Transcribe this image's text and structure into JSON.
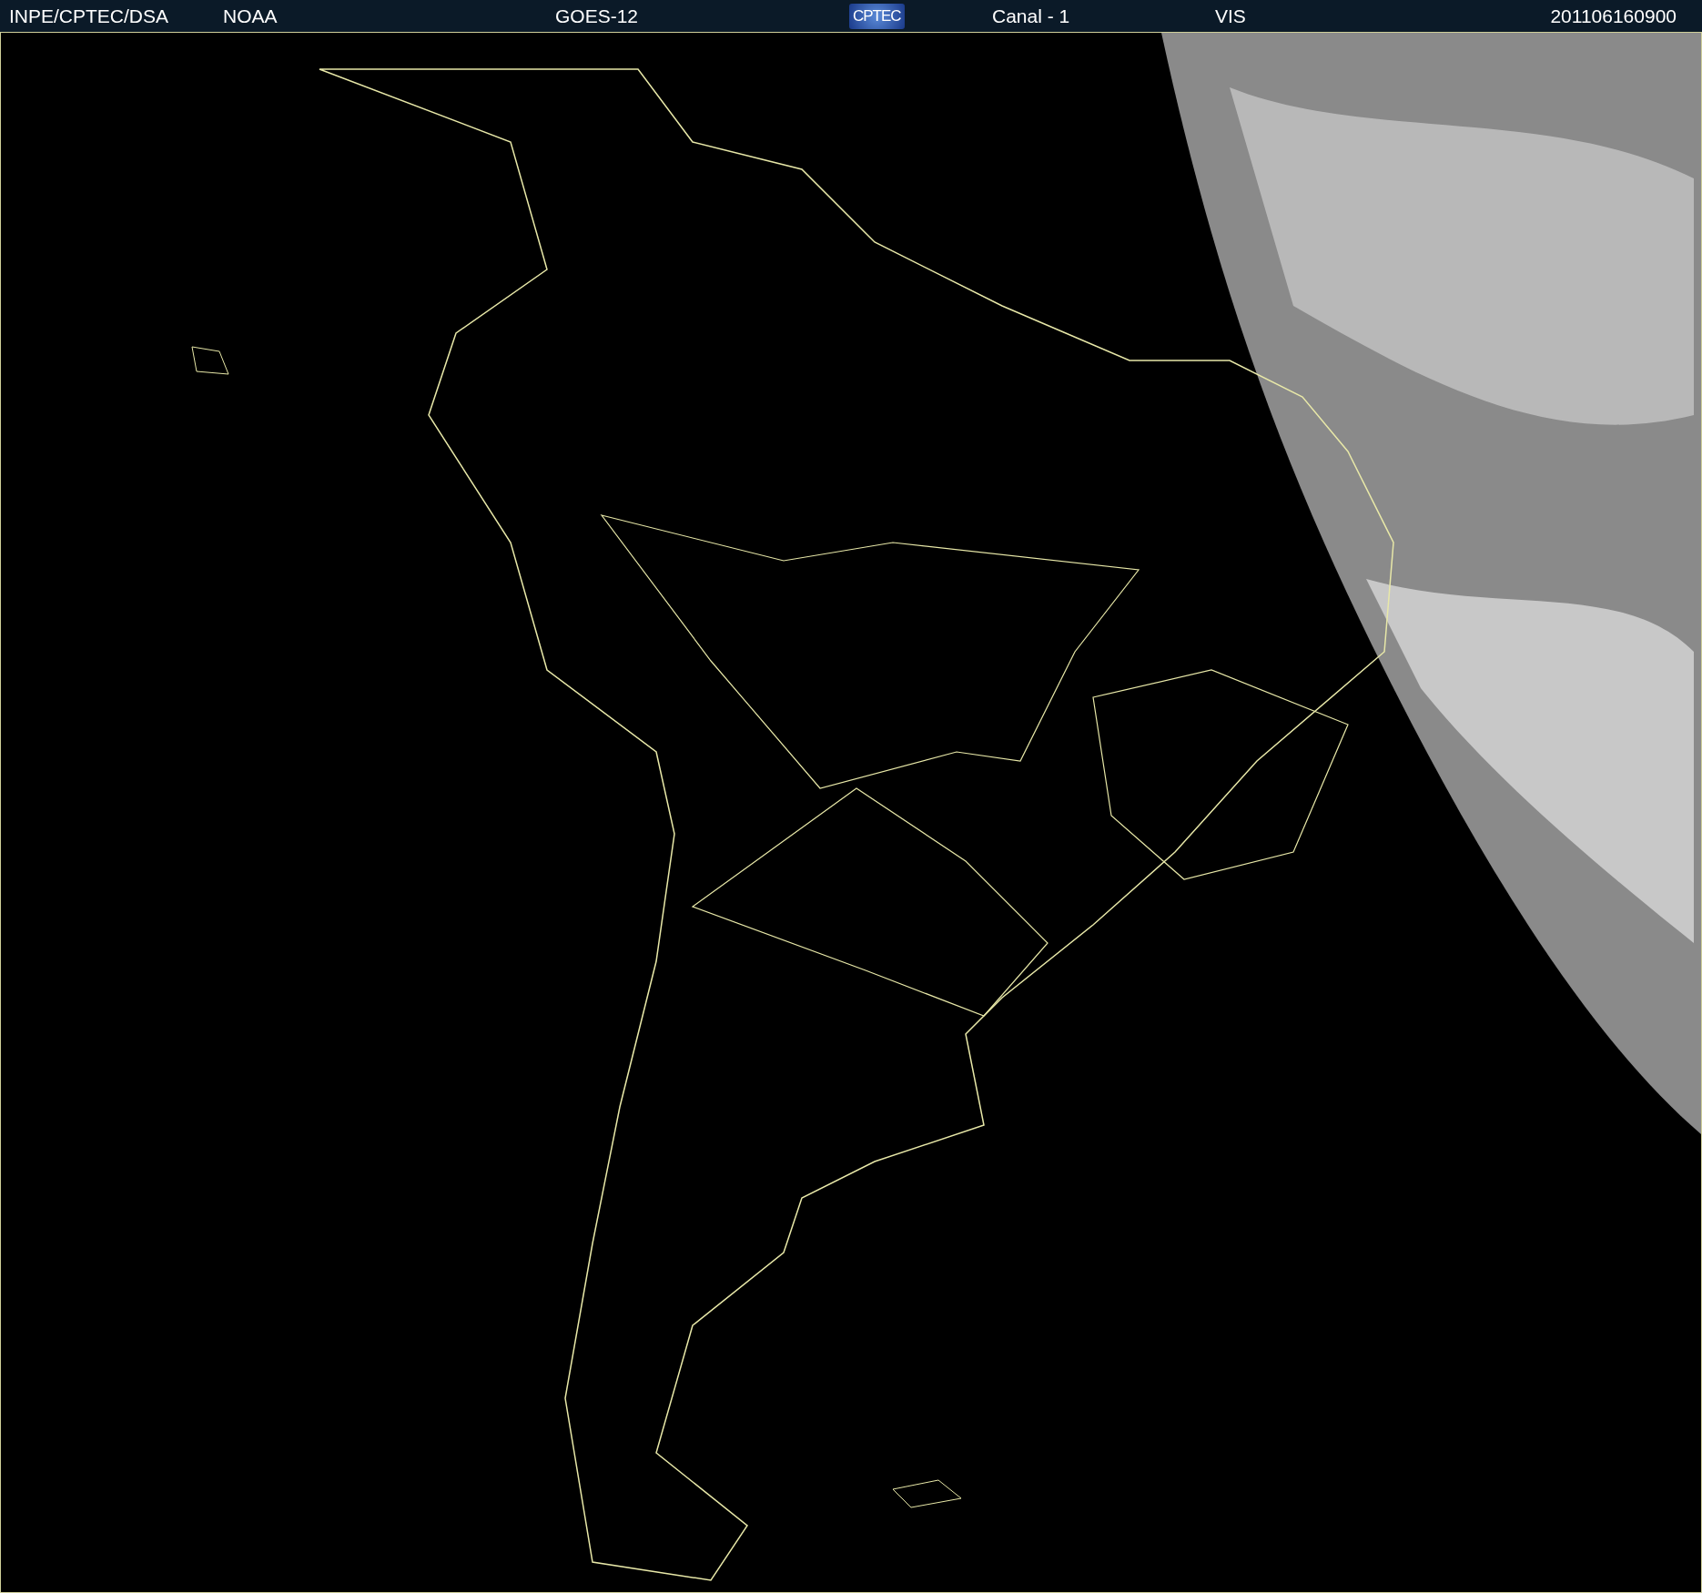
{
  "header": {
    "items": [
      {
        "kind": "text",
        "label": "INPE/CPTEC/DSA"
      },
      {
        "kind": "text",
        "label": "NOAA"
      },
      {
        "kind": "text",
        "label": "GOES-12"
      },
      {
        "kind": "logo",
        "label": "CPTEC"
      },
      {
        "kind": "text",
        "label": "Canal - 1"
      },
      {
        "kind": "text",
        "label": "VIS"
      },
      {
        "kind": "text",
        "label": "201106160900"
      }
    ]
  }
}
